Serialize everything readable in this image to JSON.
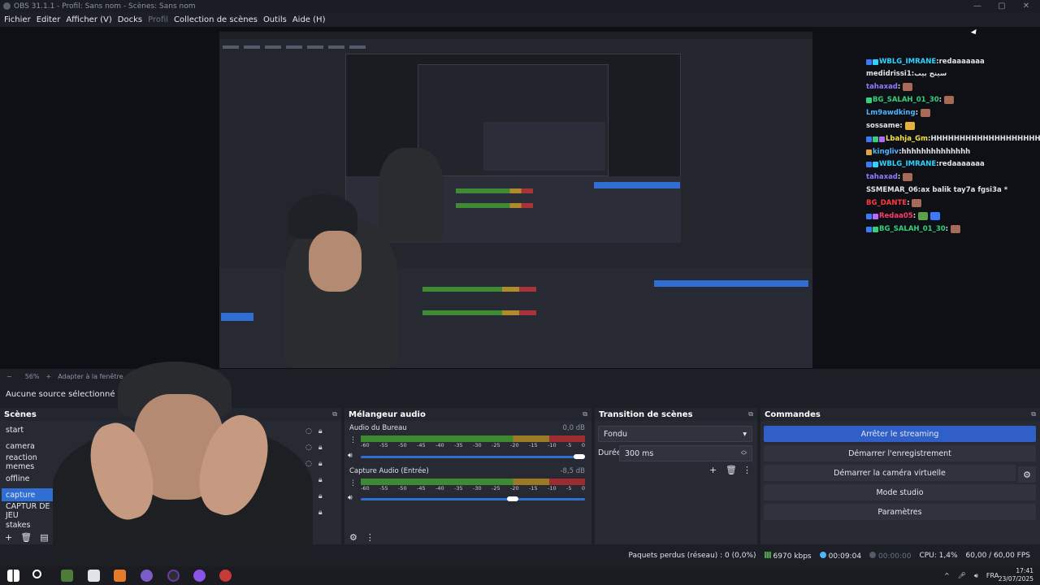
{
  "window": {
    "title": "OBS 31.1.1 - Profil: Sans nom - Scènes: Sans nom"
  },
  "menu": [
    "Fichier",
    "Editer",
    "Afficher (V)",
    "Docks",
    "Profil",
    "Collection de scènes",
    "Outils",
    "Aide (H)"
  ],
  "zoom": {
    "minus": "−",
    "level": "56%",
    "plus": "+",
    "fit": "Adapter à la fenêtre"
  },
  "source_bar": {
    "label": "Aucune source sélectionné"
  },
  "chat": [
    {
      "user": "WBLG_IMRANE",
      "msg": "redaaaaaaa",
      "color": "#2ad6ff"
    },
    {
      "user": "medidrissi1",
      "msg": "سينج بيب",
      "color": "#ffffff"
    },
    {
      "user": "tahaxad",
      "msg": "",
      "color": "#8a7cff"
    },
    {
      "user": "BG_SALAH_01_30",
      "msg": "",
      "color": "#33d17a"
    },
    {
      "user": "Lm9awdking",
      "msg": "",
      "color": "#4fb4ff"
    },
    {
      "user": "sossame",
      "msg": "",
      "color": "#ffffff"
    },
    {
      "user": "Lbahja_Gm",
      "msg": "HHHHHHHHHHHHHHHHHHHHHH",
      "color": "#f5e24b"
    },
    {
      "user": "kingliv",
      "msg": "hhhhhhhhhhhhhh",
      "color": "#4fb4ff"
    },
    {
      "user": "WBLG_IMRANE",
      "msg": "redaaaaaaa",
      "color": "#2ad6ff"
    },
    {
      "user": "tahaxad",
      "msg": "",
      "color": "#8a7cff"
    },
    {
      "user": "SSMEMAR_06",
      "msg": "ax balik tay7a fgsi3a *",
      "color": "#ffffff"
    },
    {
      "user": "BG_DANTE",
      "msg": "",
      "color": "#ff3b3b"
    },
    {
      "user": "Redaa05",
      "msg": "",
      "color": "#ff3b6b"
    },
    {
      "user": "BG_SALAH_01_30",
      "msg": "",
      "color": "#33d17a"
    }
  ],
  "scenes": {
    "title": "Scènes",
    "items": [
      "start",
      "camera",
      "reaction memes",
      "offline",
      "capture",
      "CAPTUR DE JEU",
      "stakes"
    ],
    "selected": "capture"
  },
  "mixer": {
    "title": "Mélangeur audio",
    "ticks": [
      "-60",
      "-55",
      "-50",
      "-45",
      "-40",
      "-35",
      "-30",
      "-25",
      "-20",
      "-15",
      "-10",
      "-5",
      "0"
    ],
    "tracks": [
      {
        "name": "Audio du Bureau",
        "db": "0,0 dB",
        "volume": 1.0
      },
      {
        "name": "Capture Audio (Entrée)",
        "db": "-8,5 dB",
        "volume": 0.7
      }
    ]
  },
  "transitions": {
    "title": "Transition de scènes",
    "type": "Fondu",
    "duration_label": "Durée",
    "duration": "300 ms"
  },
  "commands": {
    "title": "Commandes",
    "stop_stream": "Arrêter le streaming",
    "start_record": "Démarrer l'enregistrement",
    "start_vcam": "Démarrer la caméra virtuelle",
    "studio_mode": "Mode studio",
    "settings": "Paramètres"
  },
  "status": {
    "dropped": "Paquets perdus (réseau) : 0 (0,0%)",
    "bitrate": "6970 kbps",
    "stream_time": "00:09:04",
    "rec_time": "00:00:00",
    "cpu": "CPU: 1,4%",
    "fps": "60,00 / 60,00 FPS"
  },
  "taskbar": {
    "lang": "FRA",
    "time": "17:41",
    "date": "23/07/2025"
  },
  "colors": {
    "accent": "#2f6fd4",
    "panel": "#272a33",
    "background": "#1d1f26"
  }
}
